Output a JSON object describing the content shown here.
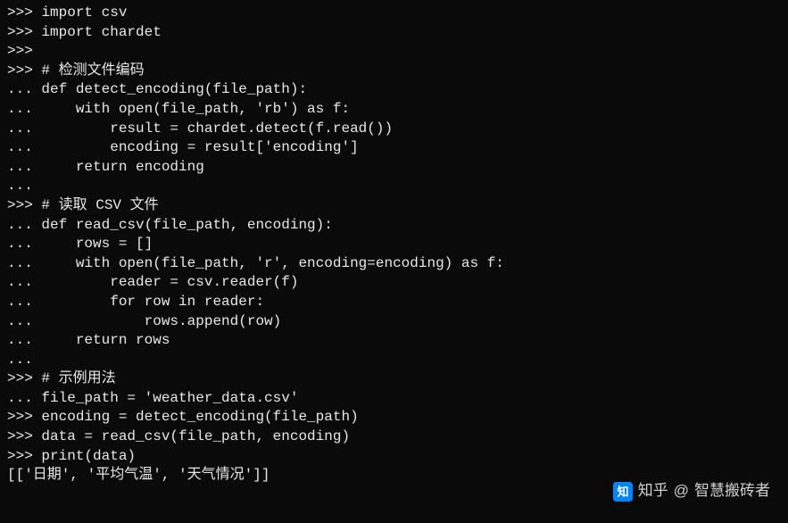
{
  "lines": [
    {
      "prompt": ">>> ",
      "text": "import csv"
    },
    {
      "prompt": ">>> ",
      "text": "import chardet"
    },
    {
      "prompt": ">>>",
      "text": ""
    },
    {
      "prompt": ">>> ",
      "text": "# 检测文件编码"
    },
    {
      "prompt": "... ",
      "text": "def detect_encoding(file_path):"
    },
    {
      "prompt": "... ",
      "text": "    with open(file_path, 'rb') as f:"
    },
    {
      "prompt": "... ",
      "text": "        result = chardet.detect(f.read())"
    },
    {
      "prompt": "... ",
      "text": "        encoding = result['encoding']"
    },
    {
      "prompt": "... ",
      "text": "    return encoding"
    },
    {
      "prompt": "...",
      "text": ""
    },
    {
      "prompt": ">>> ",
      "text": "# 读取 CSV 文件"
    },
    {
      "prompt": "... ",
      "text": "def read_csv(file_path, encoding):"
    },
    {
      "prompt": "... ",
      "text": "    rows = []"
    },
    {
      "prompt": "... ",
      "text": "    with open(file_path, 'r', encoding=encoding) as f:"
    },
    {
      "prompt": "... ",
      "text": "        reader = csv.reader(f)"
    },
    {
      "prompt": "... ",
      "text": "        for row in reader:"
    },
    {
      "prompt": "... ",
      "text": "            rows.append(row)"
    },
    {
      "prompt": "... ",
      "text": "    return rows"
    },
    {
      "prompt": "...",
      "text": ""
    },
    {
      "prompt": ">>> ",
      "text": "# 示例用法"
    },
    {
      "prompt": "... ",
      "text": "file_path = 'weather_data.csv'"
    },
    {
      "prompt": ">>> ",
      "text": "encoding = detect_encoding(file_path)"
    },
    {
      "prompt": ">>> ",
      "text": "data = read_csv(file_path, encoding)"
    },
    {
      "prompt": ">>> ",
      "text": "print(data)"
    },
    {
      "prompt": "",
      "text": "[['日期', '平均气温', '天气情况']]"
    }
  ],
  "watermark": {
    "prefix": "知乎",
    "at": "@",
    "name": "智慧搬砖者"
  }
}
